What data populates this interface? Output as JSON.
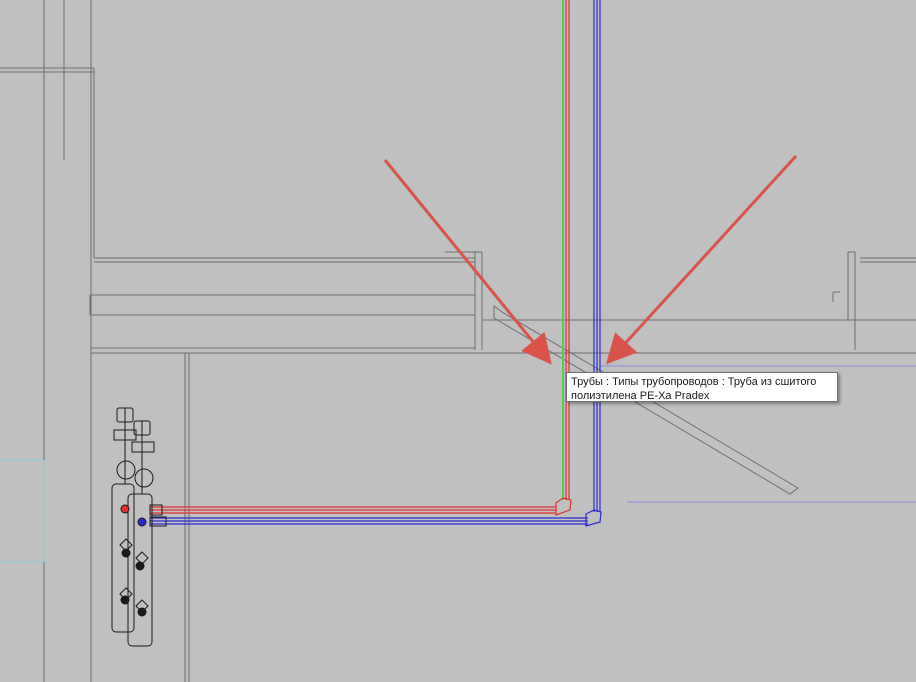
{
  "view": {
    "background": "#c0c0c0",
    "line_color": "#6e6e6e",
    "annotation_arrow_color": "#d9534a"
  },
  "pipes": {
    "supply_color": "#e03030",
    "return_color": "#2a2ad0",
    "riser_accent_color": "#4fd04f"
  },
  "tooltip": {
    "line1": "Трубы : Типы трубопроводов : Труба из сшитого",
    "line2": "полиэтилена PE-Xa Pradex"
  },
  "icons": {
    "manifold": "manifold-icon",
    "valve": "valve-icon",
    "arrow": "annotation-arrow-icon"
  }
}
